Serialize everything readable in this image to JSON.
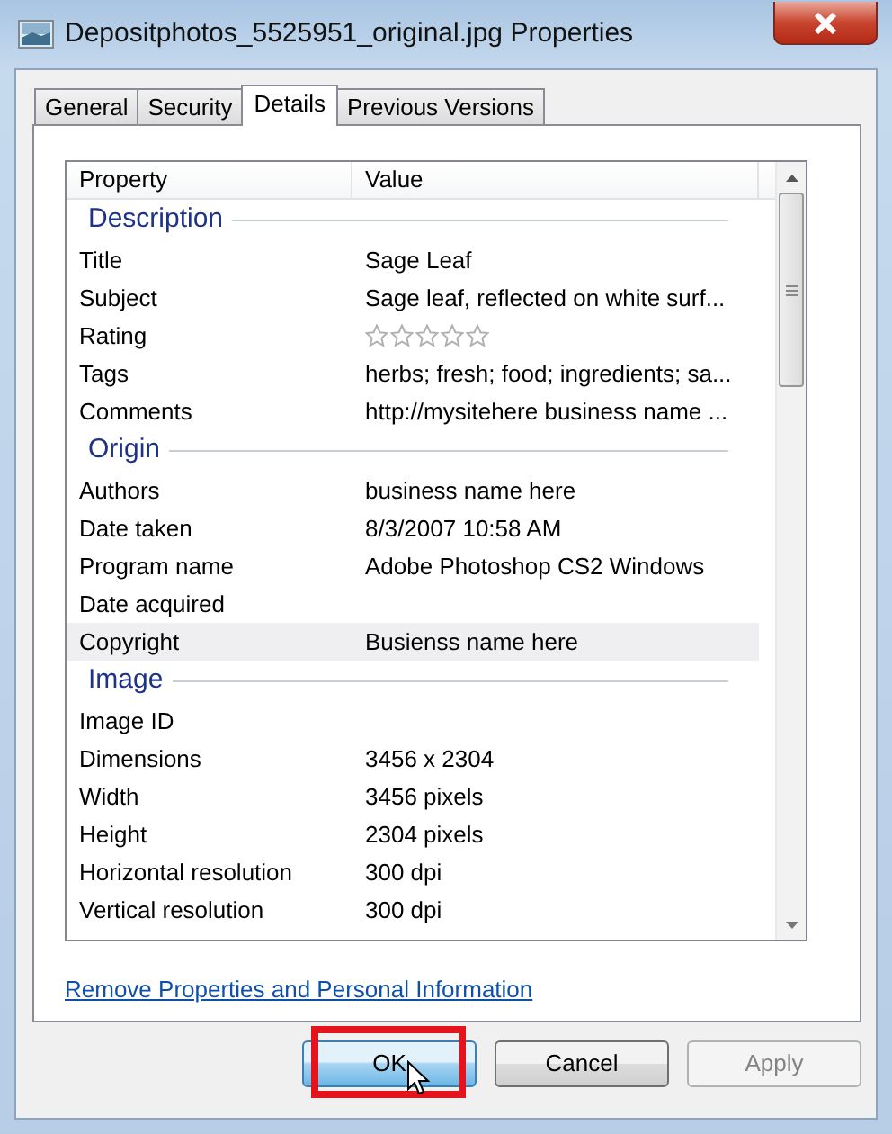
{
  "window": {
    "title": "Depositphotos_5525951_original.jpg Properties"
  },
  "tabs": [
    {
      "label": "General",
      "selected": false
    },
    {
      "label": "Security",
      "selected": false
    },
    {
      "label": "Details",
      "selected": true
    },
    {
      "label": "Previous Versions",
      "selected": false
    }
  ],
  "list": {
    "columns": [
      "Property",
      "Value"
    ],
    "groups": [
      {
        "title": "Description",
        "rows": [
          {
            "kind": "text",
            "property": "Title",
            "value": "Sage Leaf",
            "selected": false
          },
          {
            "kind": "text",
            "property": "Subject",
            "value": "Sage leaf, reflected on white surf...",
            "selected": false
          },
          {
            "kind": "rating",
            "property": "Rating",
            "stars": 0,
            "selected": false
          },
          {
            "kind": "text",
            "property": "Tags",
            "value": "herbs; fresh; food; ingredients; sa...",
            "selected": false
          },
          {
            "kind": "text",
            "property": "Comments",
            "value": "http://mysitehere business name ...",
            "selected": false
          }
        ]
      },
      {
        "title": "Origin",
        "rows": [
          {
            "kind": "text",
            "property": "Authors",
            "value": "business name here",
            "selected": false
          },
          {
            "kind": "text",
            "property": "Date taken",
            "value": "8/3/2007 10:58 AM",
            "selected": false
          },
          {
            "kind": "text",
            "property": "Program name",
            "value": "Adobe Photoshop CS2 Windows",
            "selected": false
          },
          {
            "kind": "text",
            "property": "Date acquired",
            "selected": false
          },
          {
            "kind": "text",
            "property": "Copyright",
            "value": "Busienss name here",
            "selected": true
          }
        ]
      },
      {
        "title": "Image",
        "rows": [
          {
            "kind": "text",
            "property": "Image ID",
            "selected": false
          },
          {
            "kind": "text",
            "property": "Dimensions",
            "value": "3456 x 2304",
            "selected": false
          },
          {
            "kind": "text",
            "property": "Width",
            "value": "3456 pixels",
            "selected": false
          },
          {
            "kind": "text",
            "property": "Height",
            "value": "2304 pixels",
            "selected": false
          },
          {
            "kind": "text",
            "property": "Horizontal resolution",
            "value": "300 dpi",
            "selected": false
          },
          {
            "kind": "text",
            "property": "Vertical resolution",
            "value": "300 dpi",
            "selected": false
          }
        ]
      }
    ]
  },
  "link": "Remove Properties and Personal Information",
  "buttons": [
    {
      "label": "OK",
      "default": true,
      "disabled": false
    },
    {
      "label": "Cancel",
      "default": false,
      "disabled": false
    },
    {
      "label": "Apply",
      "default": false,
      "disabled": true
    }
  ],
  "overlay": {
    "highlight_frame": true,
    "pointer": true
  }
}
